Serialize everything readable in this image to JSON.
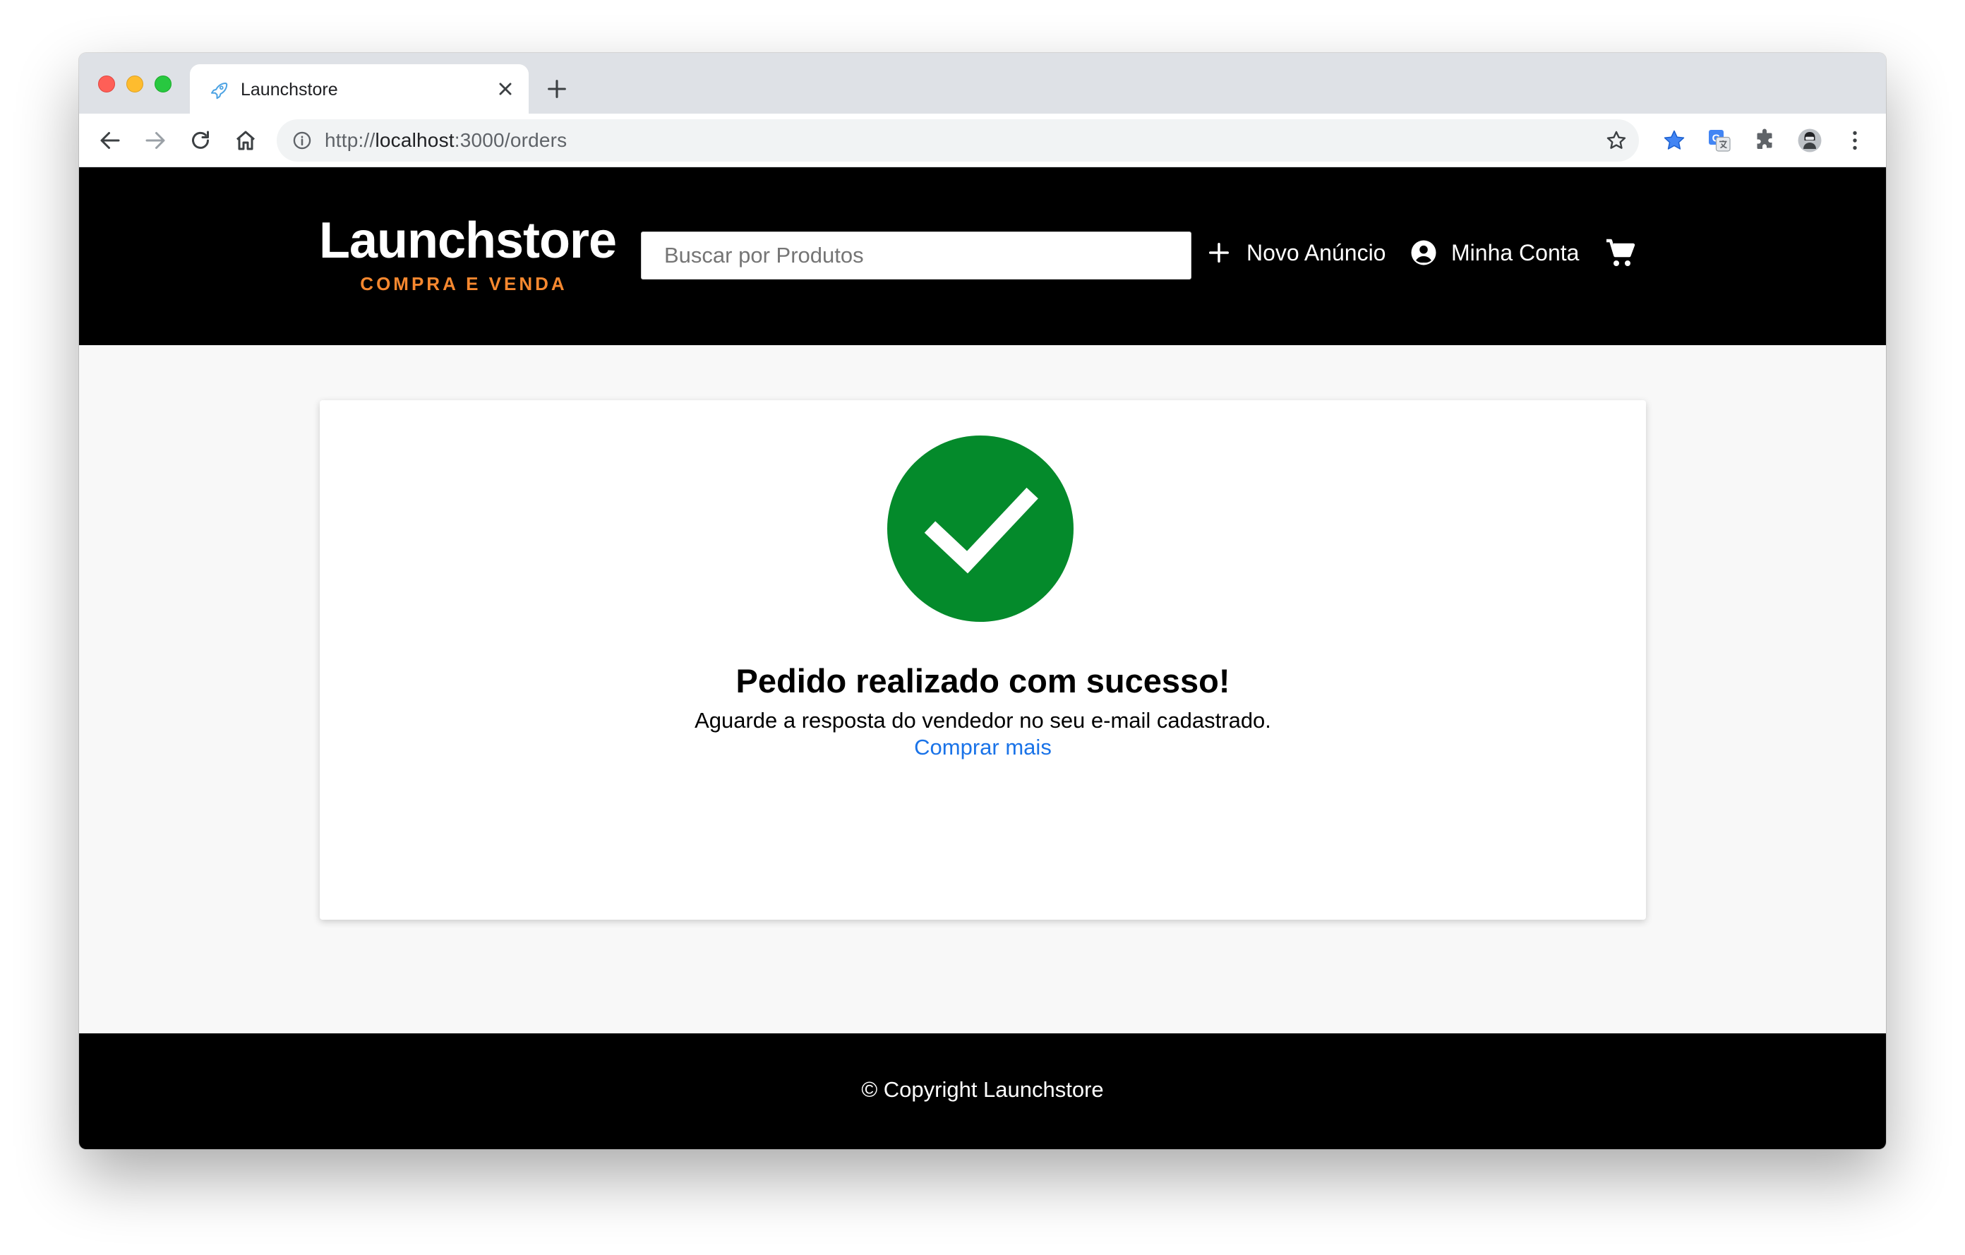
{
  "browser": {
    "tab_title": "Launchstore",
    "url_prefix": "http://",
    "url_host": "localhost",
    "url_path": ":3000/orders"
  },
  "header": {
    "logo_name": "Launchstore",
    "logo_tagline": "COMPRA E VENDA",
    "search_placeholder": "Buscar por Produtos",
    "nav_new_listing": "Novo Anúncio",
    "nav_account": "Minha Conta"
  },
  "main": {
    "title": "Pedido realizado com sucesso!",
    "subtitle": "Aguarde a resposta do vendedor no seu e-mail cadastrado.",
    "link": "Comprar mais"
  },
  "footer": {
    "copyright": "© Copyright Launchstore"
  },
  "colors": {
    "accent_orange": "#f7882f",
    "success_green": "#048a2b",
    "link_blue": "#1a73e8"
  }
}
